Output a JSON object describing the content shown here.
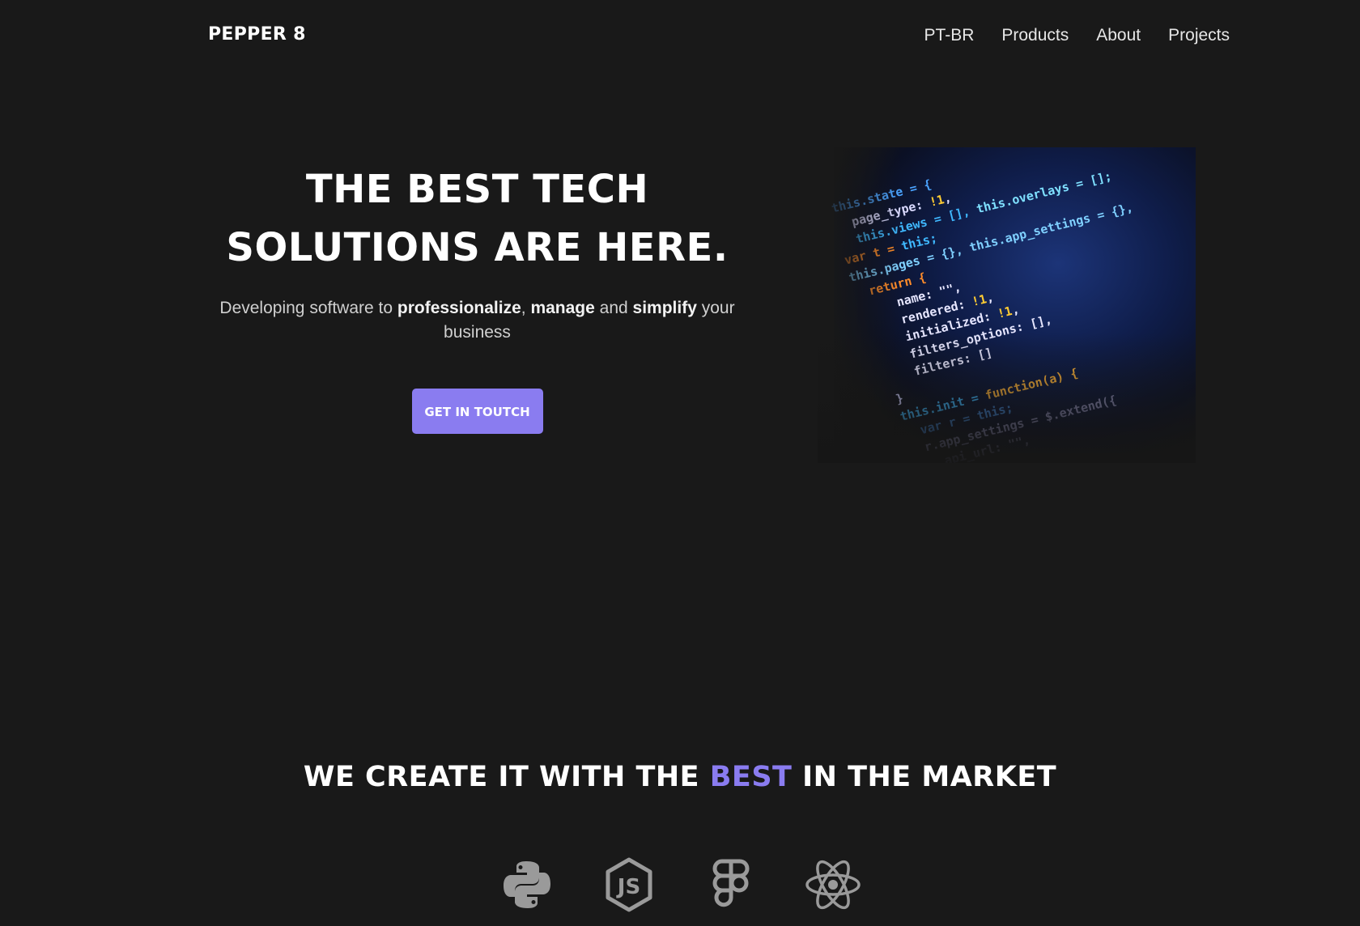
{
  "header": {
    "logo": "PEPPER 8",
    "nav": [
      "PT-BR",
      "Products",
      "About",
      "Projects"
    ]
  },
  "hero": {
    "title_line1": "THE BEST TECH",
    "title_line2": "SOLUTIONS ARE HERE.",
    "subtitle": {
      "t1": "Developing software to ",
      "b1": "professionalize",
      "t2": ", ",
      "b2": "manage",
      "t3": " and ",
      "b3": "simplify",
      "t4": " your business"
    },
    "cta_label": "GET IN TOUTCH",
    "image_icon": "code-screenshot"
  },
  "tech": {
    "title_before": "WE CREATE IT WITH THE ",
    "title_accent": "BEST",
    "title_after": " IN THE MARKET",
    "icons": [
      "python-icon",
      "nodejs-icon",
      "figma-icon",
      "react-icon"
    ]
  },
  "colors": {
    "background": "#191919",
    "accent": "#8a7cf0",
    "text": "#ffffff",
    "icon_gray": "#9a9a9a"
  }
}
